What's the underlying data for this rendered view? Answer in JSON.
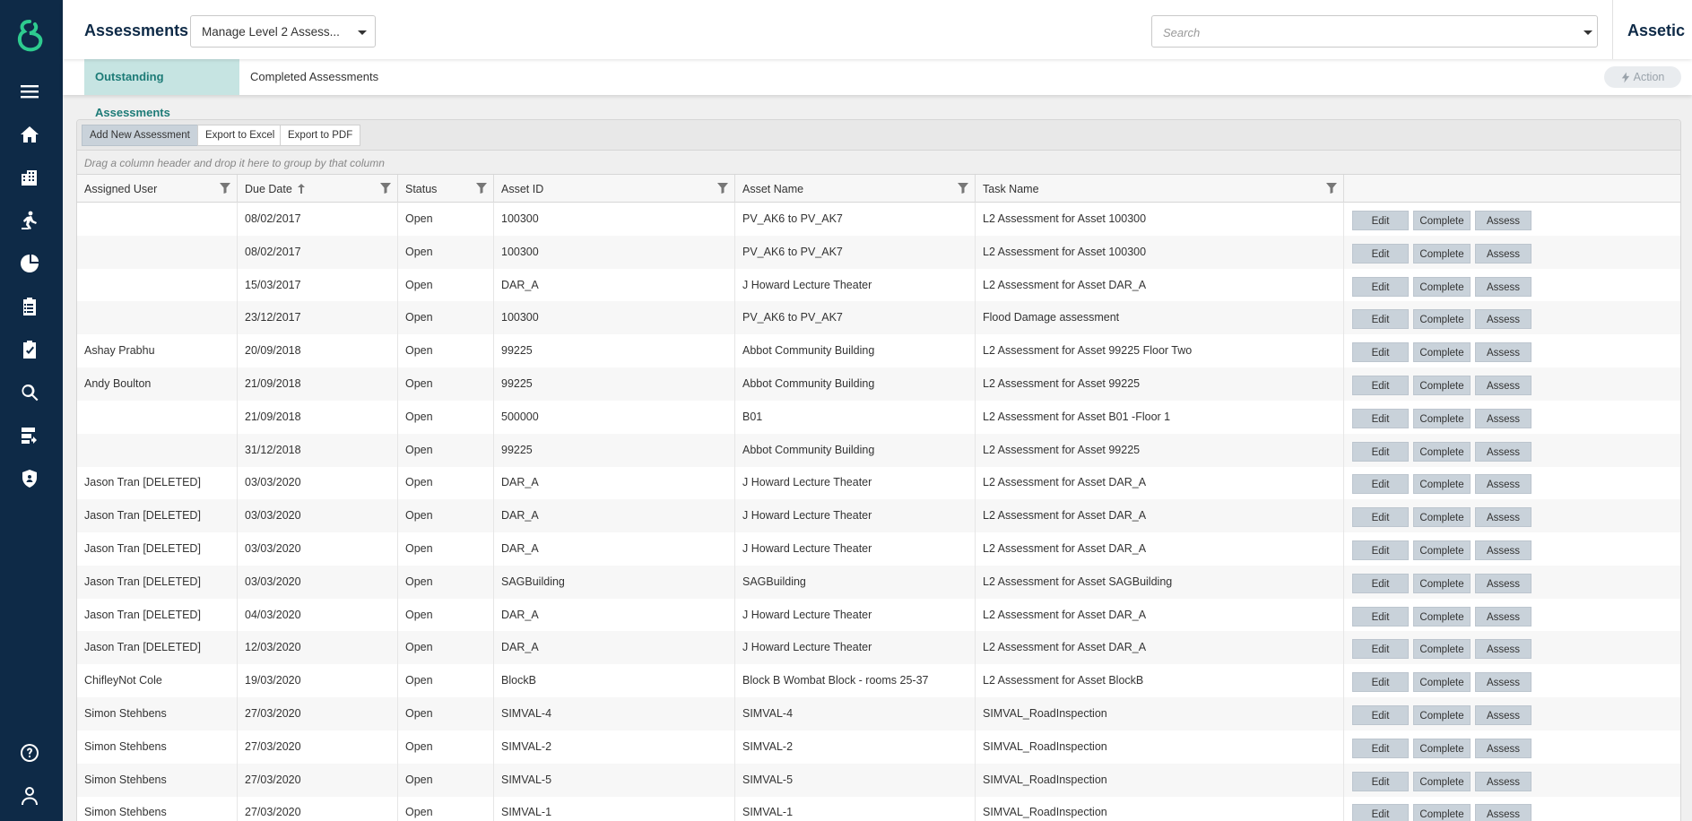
{
  "header": {
    "title": "Assessments",
    "assessment_select": "Manage Level 2 Assess...",
    "search_placeholder": "Search",
    "brand": "Assetic"
  },
  "tabs": [
    {
      "label": "Outstanding Assessments",
      "active": true
    },
    {
      "label": "Completed Assessments",
      "active": false
    }
  ],
  "action_label": "Action",
  "toolbar": {
    "add_new": "Add New Assessment",
    "export_excel": "Export to Excel",
    "export_pdf": "Export to PDF"
  },
  "group_hint": "Drag a column header and drop it here to group by that column",
  "columns": [
    "Assigned User",
    "Due Date",
    "Status",
    "Asset ID",
    "Asset Name",
    "Task Name"
  ],
  "row_actions": [
    "Edit",
    "Complete",
    "Assess"
  ],
  "rows": [
    {
      "user": "",
      "due": "08/02/2017",
      "status": "Open",
      "asset_id": "100300",
      "asset_name": "PV_AK6 to PV_AK7",
      "task": "L2 Assessment for Asset 100300"
    },
    {
      "user": "",
      "due": "08/02/2017",
      "status": "Open",
      "asset_id": "100300",
      "asset_name": "PV_AK6 to PV_AK7",
      "task": "L2 Assessment for Asset 100300"
    },
    {
      "user": "",
      "due": "15/03/2017",
      "status": "Open",
      "asset_id": "DAR_A",
      "asset_name": "J Howard Lecture Theater",
      "task": "L2 Assessment for Asset DAR_A"
    },
    {
      "user": "",
      "due": "23/12/2017",
      "status": "Open",
      "asset_id": "100300",
      "asset_name": "PV_AK6 to PV_AK7",
      "task": "Flood Damage assessment"
    },
    {
      "user": "Ashay Prabhu",
      "due": "20/09/2018",
      "status": "Open",
      "asset_id": "99225",
      "asset_name": "Abbot Community Building",
      "task": "L2 Assessment for Asset 99225 Floor Two"
    },
    {
      "user": "Andy Boulton",
      "due": "21/09/2018",
      "status": "Open",
      "asset_id": "99225",
      "asset_name": "Abbot Community Building",
      "task": "L2 Assessment for Asset 99225"
    },
    {
      "user": "",
      "due": "21/09/2018",
      "status": "Open",
      "asset_id": "500000",
      "asset_name": "B01",
      "task": "L2 Assessment for Asset B01 -Floor 1"
    },
    {
      "user": "",
      "due": "31/12/2018",
      "status": "Open",
      "asset_id": "99225",
      "asset_name": "Abbot Community Building",
      "task": "L2 Assessment for Asset 99225"
    },
    {
      "user": "Jason Tran [DELETED]",
      "due": "03/03/2020",
      "status": "Open",
      "asset_id": "DAR_A",
      "asset_name": "J Howard Lecture Theater",
      "task": "L2 Assessment for Asset DAR_A"
    },
    {
      "user": "Jason Tran [DELETED]",
      "due": "03/03/2020",
      "status": "Open",
      "asset_id": "DAR_A",
      "asset_name": "J Howard Lecture Theater",
      "task": "L2 Assessment for Asset DAR_A"
    },
    {
      "user": "Jason Tran [DELETED]",
      "due": "03/03/2020",
      "status": "Open",
      "asset_id": "DAR_A",
      "asset_name": "J Howard Lecture Theater",
      "task": "L2 Assessment for Asset DAR_A"
    },
    {
      "user": "Jason Tran [DELETED]",
      "due": "03/03/2020",
      "status": "Open",
      "asset_id": "SAGBuilding",
      "asset_name": "SAGBuilding",
      "task": "L2 Assessment for Asset SAGBuilding"
    },
    {
      "user": "Jason Tran [DELETED]",
      "due": "04/03/2020",
      "status": "Open",
      "asset_id": "DAR_A",
      "asset_name": "J Howard Lecture Theater",
      "task": "L2 Assessment for Asset DAR_A"
    },
    {
      "user": "Jason Tran [DELETED]",
      "due": "12/03/2020",
      "status": "Open",
      "asset_id": "DAR_A",
      "asset_name": "J Howard Lecture Theater",
      "task": "L2 Assessment for Asset DAR_A"
    },
    {
      "user": "ChifleyNot Cole",
      "due": "19/03/2020",
      "status": "Open",
      "asset_id": "BlockB",
      "asset_name": "Block B Wombat Block - rooms 25-37",
      "task": "L2 Assessment for Asset BlockB"
    },
    {
      "user": "Simon Stehbens",
      "due": "27/03/2020",
      "status": "Open",
      "asset_id": "SIMVAL-4",
      "asset_name": "SIMVAL-4",
      "task": "SIMVAL_RoadInspection"
    },
    {
      "user": "Simon Stehbens",
      "due": "27/03/2020",
      "status": "Open",
      "asset_id": "SIMVAL-2",
      "asset_name": "SIMVAL-2",
      "task": "SIMVAL_RoadInspection"
    },
    {
      "user": "Simon Stehbens",
      "due": "27/03/2020",
      "status": "Open",
      "asset_id": "SIMVAL-5",
      "asset_name": "SIMVAL-5",
      "task": "SIMVAL_RoadInspection"
    },
    {
      "user": "Simon Stehbens",
      "due": "27/03/2020",
      "status": "Open",
      "asset_id": "SIMVAL-1",
      "asset_name": "SIMVAL-1",
      "task": "SIMVAL_RoadInspection"
    }
  ],
  "sidebar_icons": [
    "menu-icon",
    "home-icon",
    "buildings-icon",
    "worker-icon",
    "finance-icon",
    "clipboard-list-icon",
    "assessment-icon",
    "search-icon",
    "data-import-icon",
    "security-shield-icon",
    "help-icon",
    "user-icon"
  ],
  "colors": {
    "sidebar": "#0e2a47",
    "brand_green": "#2ecc8f",
    "active_tab_bg": "#c6e4e2",
    "active_tab_text": "#1d7b77",
    "row_button": "#c9d2da"
  }
}
